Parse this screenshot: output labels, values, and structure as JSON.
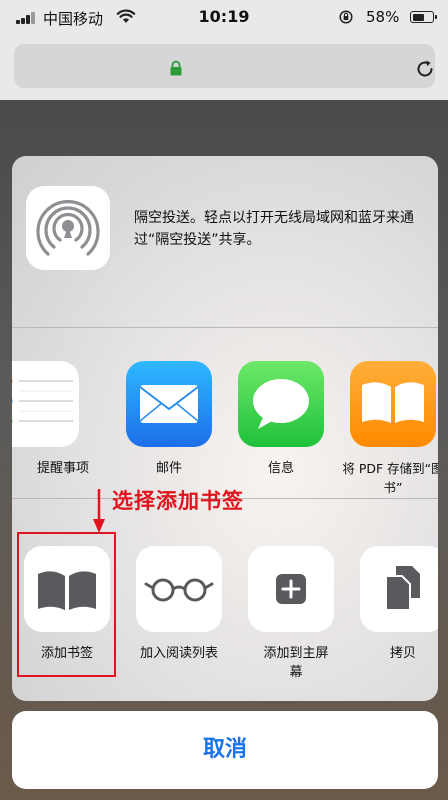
{
  "status_bar": {
    "carrier": "中国移动",
    "time": "10:19",
    "battery": "58%",
    "battery_level": 0.58
  },
  "share_sheet": {
    "airdrop_text": "隔空投送。轻点以打开无线局域网和蓝牙来通过“隔空投送”共享。",
    "apps": [
      {
        "label": "提醒事项",
        "icon": "reminders-icon"
      },
      {
        "label": "邮件",
        "icon": "mail-icon"
      },
      {
        "label": "信息",
        "icon": "messages-icon"
      },
      {
        "label": "将 PDF 存储到“图书”",
        "icon": "books-icon"
      }
    ],
    "actions": [
      {
        "label": "添加书签",
        "icon": "bookmark-book-icon"
      },
      {
        "label": "加入阅读列表",
        "icon": "reading-glasses-icon"
      },
      {
        "label": "添加到主屏幕",
        "icon": "add-square-icon"
      },
      {
        "label": "拷贝",
        "icon": "copy-doc-icon"
      }
    ],
    "annotation": "选择添加书签",
    "cancel": "取消"
  },
  "colors": {
    "annotation": "#e0141e",
    "cancel_text": "#1a73e8",
    "padlock": "#2a9d3a"
  }
}
